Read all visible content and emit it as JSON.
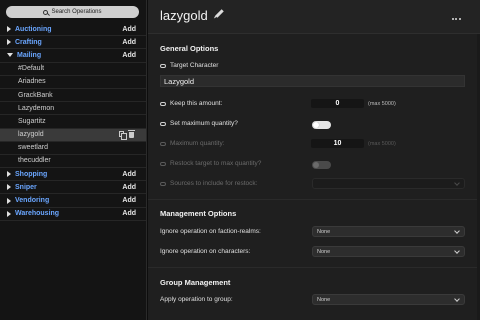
{
  "sidebar": {
    "search_placeholder": "Search Operations",
    "categories": [
      {
        "label": "Auctioning",
        "add": "Add",
        "open": false
      },
      {
        "label": "Crafting",
        "add": "Add",
        "open": false
      },
      {
        "label": "Mailing",
        "add": "Add",
        "open": true
      },
      {
        "label": "Shopping",
        "add": "Add",
        "open": false
      },
      {
        "label": "Sniper",
        "add": "Add",
        "open": false
      },
      {
        "label": "Vendoring",
        "add": "Add",
        "open": false
      },
      {
        "label": "Warehousing",
        "add": "Add",
        "open": false
      }
    ],
    "mailing_items": [
      "#Default",
      "Ariadnes",
      "GrackBank",
      "Lazydemon",
      "Sugartitz",
      "lazygold",
      "sweetlard",
      "thecuddler"
    ],
    "selected_item": "lazygold"
  },
  "header": {
    "title": "lazygold",
    "icons": {
      "edit": "pencil-icon",
      "menu": "more-icon"
    }
  },
  "general": {
    "title": "General Options",
    "target_label": "Target Character",
    "target_value": "Lazygold",
    "keep_label": "Keep this amount:",
    "keep_value": "0",
    "keep_hint": "(max 5000)",
    "setmax_label": "Set maximum quantity?",
    "setmax_on": true,
    "maxq_label": "Maximum quantity:",
    "maxq_value": "10",
    "maxq_hint": "(max 5000)",
    "restock_label": "Restock target to max quantity?",
    "restock_on": false,
    "sources_label": "Sources to include for restock:",
    "sources_value": ""
  },
  "management": {
    "title": "Management Options",
    "ignore_realms_label": "Ignore operation on faction-realms:",
    "ignore_realms_value": "None",
    "ignore_chars_label": "Ignore operation on characters:",
    "ignore_chars_value": "None"
  },
  "group": {
    "title": "Group Management",
    "apply_label": "Apply operation to group:",
    "apply_value": "None"
  },
  "colors": {
    "accent": "#6aa6ff",
    "panel": "#1f1f1f",
    "sidebar": "#141414"
  }
}
